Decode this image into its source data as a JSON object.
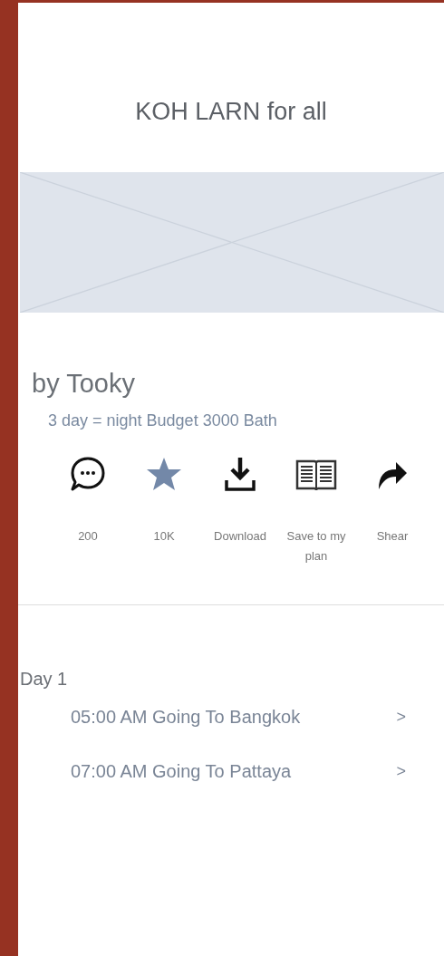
{
  "header": {
    "title": "KOH LARN for all"
  },
  "trip": {
    "author": "by Tooky",
    "summary": "3 day = night Budget 3000 Bath"
  },
  "actions": [
    {
      "kind": "comment",
      "label": "200"
    },
    {
      "kind": "star",
      "label": "10K"
    },
    {
      "kind": "download",
      "label": "Download"
    },
    {
      "kind": "book",
      "label": "Save to my plan"
    },
    {
      "kind": "share",
      "label": "Shear"
    }
  ],
  "days": [
    {
      "title": "Day 1",
      "items": [
        {
          "text": "05:00 AM Going To Bangkok",
          "chevron": ">"
        },
        {
          "text": "07:00 AM Going To Pattaya",
          "chevron": ">"
        }
      ]
    }
  ]
}
